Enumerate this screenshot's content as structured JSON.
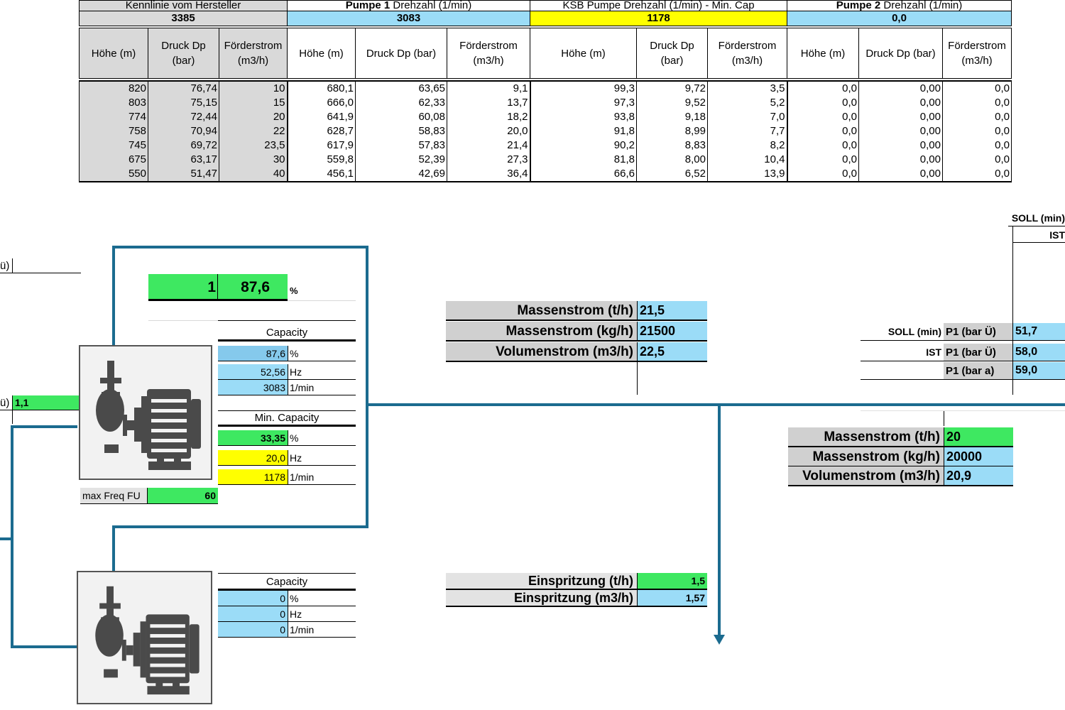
{
  "table": {
    "groups": [
      {
        "title": "Kennlinie vom Hersteller",
        "speed": "3385"
      },
      {
        "title_bold": "Pumpe 1",
        "title": " Drehzahl (1/min)",
        "speed": "3083"
      },
      {
        "title": "KSB Pumpe Drehzahl (1/min) - Min. Cap",
        "speed": "1178"
      },
      {
        "title_bold": "Pumpe 2",
        "title": " Drehzahl (1/min)",
        "speed": "0,0"
      }
    ],
    "col_headers": [
      "Höhe (m)",
      "Druck Dp (bar)",
      "Förderstrom (m3/h)",
      "Höhe (m)",
      "Druck Dp (bar)",
      "Förderstrom (m3/h)",
      "Höhe (m)",
      "Druck Dp (bar)",
      "Förderstrom (m3/h)",
      "Höhe (m)",
      "Druck Dp (bar)",
      "Förderstrom (m3/h)"
    ],
    "rows": [
      [
        "820",
        "76,74",
        "10",
        "680,1",
        "63,65",
        "9,1",
        "99,3",
        "9,72",
        "3,5",
        "0,0",
        "0,00",
        "0,0"
      ],
      [
        "803",
        "75,15",
        "15",
        "666,0",
        "62,33",
        "13,7",
        "97,3",
        "9,52",
        "5,2",
        "0,0",
        "0,00",
        "0,0"
      ],
      [
        "774",
        "72,44",
        "20",
        "641,9",
        "60,08",
        "18,2",
        "93,8",
        "9,18",
        "7,0",
        "0,0",
        "0,00",
        "0,0"
      ],
      [
        "758",
        "70,94",
        "22",
        "628,7",
        "58,83",
        "20,0",
        "91,8",
        "8,99",
        "7,7",
        "0,0",
        "0,00",
        "0,0"
      ],
      [
        "745",
        "69,72",
        "23,5",
        "617,9",
        "57,83",
        "21,4",
        "90,2",
        "8,83",
        "8,2",
        "0,0",
        "0,00",
        "0,0"
      ],
      [
        "675",
        "63,17",
        "30",
        "559,8",
        "52,39",
        "27,3",
        "81,8",
        "8,00",
        "10,4",
        "0,0",
        "0,00",
        "0,0"
      ],
      [
        "550",
        "51,47",
        "40",
        "456,1",
        "42,69",
        "36,4",
        "66,6",
        "6,52",
        "13,9",
        "0,0",
        "0,00",
        "0,0"
      ]
    ]
  },
  "pump1": {
    "count": "1",
    "percent_total": "87,6",
    "percent_unit": "%",
    "capacity_label": "Capacity",
    "capacity": [
      {
        "value": "87,6",
        "unit": "%"
      },
      {
        "value": "52,56",
        "unit": "Hz"
      },
      {
        "value": "3083",
        "unit": "1/min"
      }
    ],
    "min_capacity_label": "Min. Capacity",
    "min_capacity": [
      {
        "value": "33,35",
        "unit": "%"
      },
      {
        "value": "20,0",
        "unit": "Hz"
      },
      {
        "value": "1178",
        "unit": "1/min"
      }
    ],
    "max_freq_label": "max Freq FU",
    "max_freq_value": "60"
  },
  "pump2": {
    "capacity_label": "Capacity",
    "capacity": [
      {
        "value": "0",
        "unit": "%"
      },
      {
        "value": "0",
        "unit": "Hz"
      },
      {
        "value": "0",
        "unit": "1/min"
      }
    ]
  },
  "left_fragments": {
    "top": "ü)",
    "bottom_label": "ü)",
    "bottom_value": "1,1"
  },
  "flow1": [
    {
      "label": "Massenstrom (t/h)",
      "value": "21,5"
    },
    {
      "label": "Massenstrom (kg/h)",
      "value": "21500"
    },
    {
      "label": "Volumenstrom (m3/h)",
      "value": "22,5"
    }
  ],
  "flow2": [
    {
      "label": "Massenstrom (t/h)",
      "value": "20"
    },
    {
      "label": "Massenstrom (kg/h)",
      "value": "20000"
    },
    {
      "label": "Volumenstrom (m3/h)",
      "value": "20,9"
    }
  ],
  "pressure": {
    "top_soll": "SOLL (min)",
    "top_ist": "IST",
    "rows": [
      {
        "prefix": "SOLL (min)",
        "label": "P1 (bar Ü)",
        "value": "51,7"
      },
      {
        "prefix": "IST",
        "label": "P1 (bar Ü)",
        "value": "58,0"
      },
      {
        "prefix": "",
        "label": "P1 (bar a)",
        "value": "59,0"
      }
    ]
  },
  "injection": [
    {
      "label": "Einspritzung (t/h)",
      "value": "1,5"
    },
    {
      "label": "Einspritzung (m3/h)",
      "value": "1,57"
    }
  ]
}
